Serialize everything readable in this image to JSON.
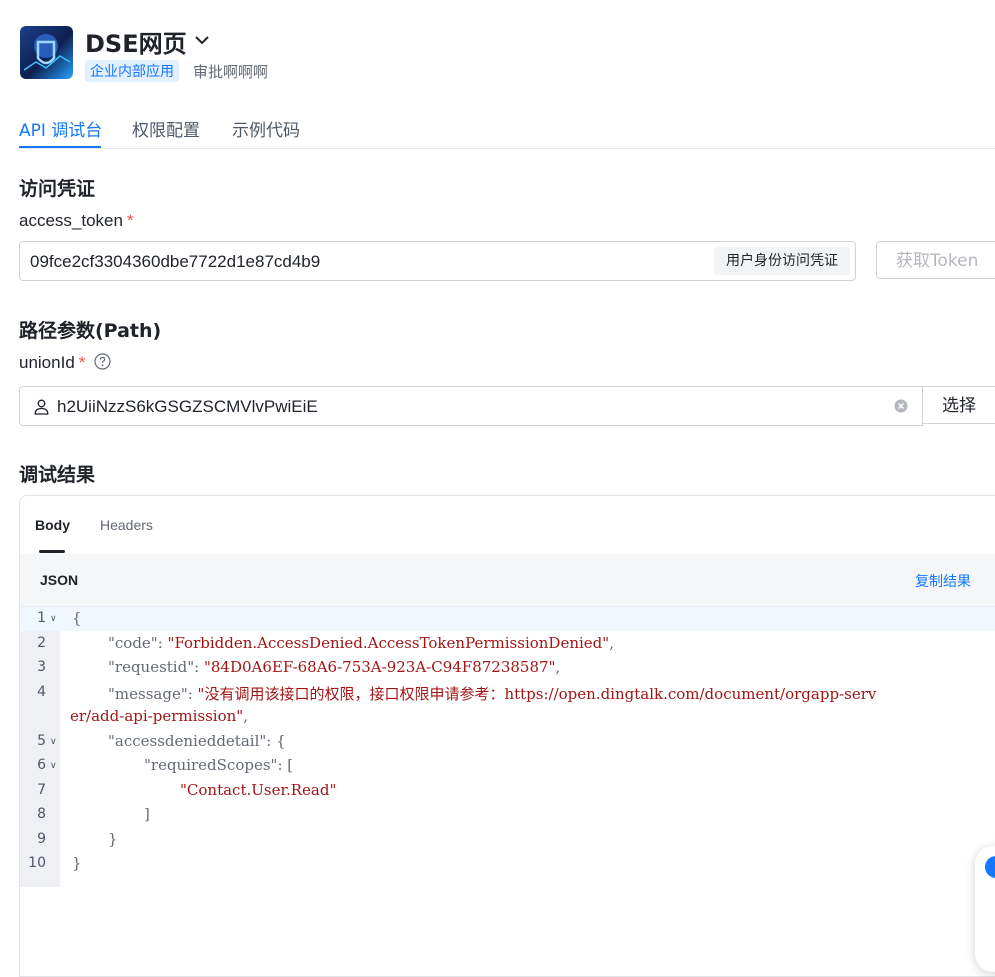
{
  "app": {
    "title": "DSE网页",
    "tag": "企业内部应用",
    "subtitle": "审批啊啊啊"
  },
  "tabs": [
    "API 调试台",
    "权限配置",
    "示例代码"
  ],
  "credentials": {
    "section_title": "访问凭证",
    "field_label": "access_token",
    "required_mark": "*",
    "value": "09fce2cf3304360dbe7722d1e87cd4b9",
    "token_type": "用户身份访问凭证",
    "get_token_button": "获取Token"
  },
  "path_params": {
    "section_title": "路径参数(Path)",
    "field_label": "unionId",
    "required_mark": "*",
    "value": "h2UiiNzzS6kGSGZSCMVlvPwiEiE",
    "select_button": "选择"
  },
  "result": {
    "section_title": "调试结果",
    "tabs": [
      "Body",
      "Headers"
    ],
    "format_label": "JSON",
    "copy_button": "复制结果",
    "lines": [
      {
        "n": "1",
        "fold": true,
        "indent": 0,
        "parts": [
          {
            "t": "{",
            "c": "k"
          }
        ]
      },
      {
        "n": "2",
        "fold": false,
        "indent": 1,
        "parts": [
          {
            "t": "\"code\"",
            "c": "k"
          },
          {
            "t": ": ",
            "c": "k"
          },
          {
            "t": "\"Forbidden.AccessDenied.AccessTokenPermissionDenied\"",
            "c": "s"
          },
          {
            "t": ",",
            "c": "k"
          }
        ]
      },
      {
        "n": "3",
        "fold": false,
        "indent": 1,
        "parts": [
          {
            "t": "\"requestid\"",
            "c": "k"
          },
          {
            "t": ": ",
            "c": "k"
          },
          {
            "t": "\"84D0A6EF-68A6-753A-923A-C94F87238587\"",
            "c": "s"
          },
          {
            "t": ",",
            "c": "k"
          }
        ]
      },
      {
        "n": "4",
        "fold": false,
        "indent": 1,
        "parts": [
          {
            "t": "\"message\"",
            "c": "k"
          },
          {
            "t": ": ",
            "c": "k"
          },
          {
            "t": "\"没有调用该接口的权限，接口权限申请参考：https://open.dingtalk.com/document/orgapp-serv",
            "c": "s"
          }
        ]
      },
      {
        "n": "",
        "fold": false,
        "indent": 0,
        "parts": [
          {
            "t": "er/add-api-permission\"",
            "c": "s"
          },
          {
            "t": ",",
            "c": "k"
          }
        ]
      },
      {
        "n": "5",
        "fold": true,
        "indent": 1,
        "parts": [
          {
            "t": "\"accessdenieddetail\"",
            "c": "k"
          },
          {
            "t": ": {",
            "c": "k"
          }
        ]
      },
      {
        "n": "6",
        "fold": true,
        "indent": 2,
        "parts": [
          {
            "t": "\"requiredScopes\"",
            "c": "k"
          },
          {
            "t": ": [",
            "c": "k"
          }
        ]
      },
      {
        "n": "7",
        "fold": false,
        "indent": 3,
        "parts": [
          {
            "t": "\"Contact.User.Read\"",
            "c": "s"
          }
        ]
      },
      {
        "n": "8",
        "fold": false,
        "indent": 2,
        "parts": [
          {
            "t": "]",
            "c": "k"
          }
        ]
      },
      {
        "n": "9",
        "fold": false,
        "indent": 1,
        "parts": [
          {
            "t": "}",
            "c": "k"
          }
        ]
      },
      {
        "n": "10",
        "fold": false,
        "indent": 0,
        "parts": [
          {
            "t": "}",
            "c": "k"
          }
        ]
      }
    ]
  },
  "colors": {
    "accent": "#1677ff",
    "required": "#f54a45",
    "json_string": "#a31515"
  },
  "icons": [
    "chevron-down-icon",
    "help-icon",
    "user-icon",
    "clear-icon",
    "fold-arrow-icon"
  ]
}
